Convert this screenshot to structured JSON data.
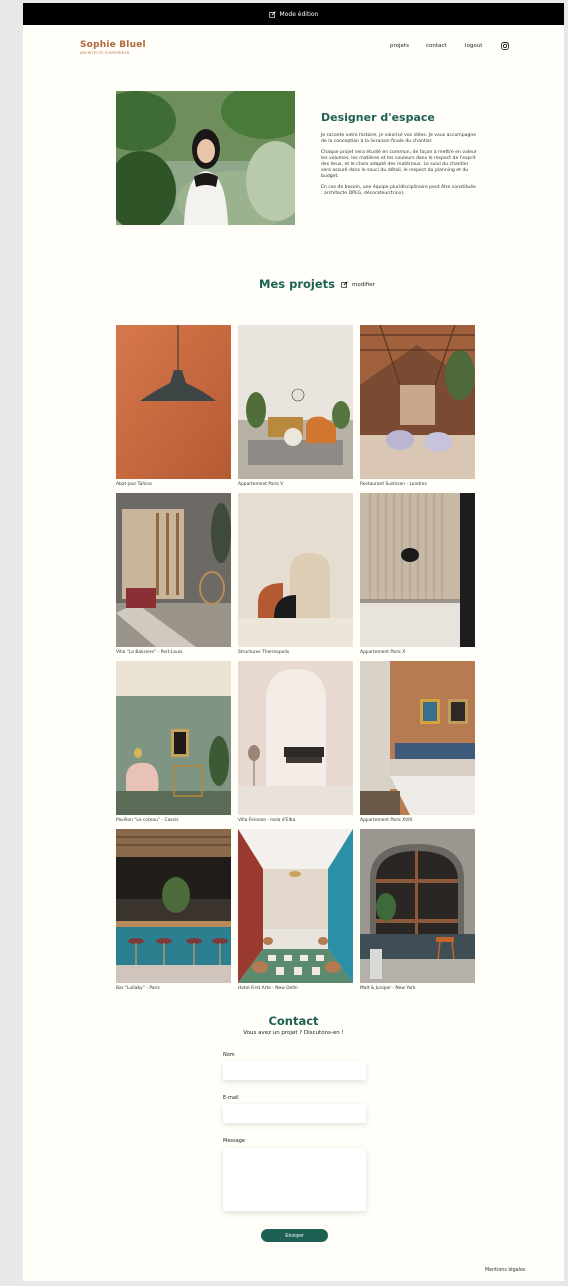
{
  "edit_bar": {
    "label": "Mode édition"
  },
  "brand": {
    "name": "Sophie Bluel",
    "subtitle": "ARCHITECTE D'INTERIEUR"
  },
  "nav": {
    "projects": "projets",
    "contact": "contact",
    "logout": "logout",
    "instagram_icon": "instagram-icon"
  },
  "intro": {
    "title": "Designer d'espace",
    "paragraphs": [
      "Je raconte votre histoire, je valorise vos idées. Je vous accompagne de la conception à la livraison finale du chantier.",
      "Chaque projet sera étudié en commun, de façon à mettre en valeur les volumes, les matières et les couleurs dans le respect de l'esprit des lieux, et le choix adapté des matériaux. Le suivi du chantier sera assuré dans le souci du détail, le respect du planning et du budget.",
      "En cas de besoin, une équipe pluridisciplinaire peut être constituée : architecte DPLG, décorateur(trice)."
    ]
  },
  "projects": {
    "title": "Mes projets",
    "modify_label": "modifier",
    "items": [
      {
        "caption": "Abat-jour Tahina"
      },
      {
        "caption": "Appartement Paris V"
      },
      {
        "caption": "Restaurant Sushisen - Londres"
      },
      {
        "caption": "Villa “La Balisiere” - Port-Louis"
      },
      {
        "caption": "Structures Thermopolis"
      },
      {
        "caption": "Appartement Paris X"
      },
      {
        "caption": "Pavillon “Le coteau” - Cassis"
      },
      {
        "caption": "Villa Ferneze - Isola d'Elba"
      },
      {
        "caption": "Appartement Paris XVIII"
      },
      {
        "caption": "Bar “Lullaby” - Paris"
      },
      {
        "caption": "Hotel First Arte - New Delhi"
      },
      {
        "caption": "Malt & Juniper - New York"
      }
    ]
  },
  "contact": {
    "title": "Contact",
    "subtitle": "Vous avez un projet ? Discutons-en !",
    "name_label": "Nom",
    "email_label": "E-mail",
    "message_label": "Message",
    "submit_label": "Envoyer"
  },
  "footer": {
    "legal": "Mentions légales"
  }
}
